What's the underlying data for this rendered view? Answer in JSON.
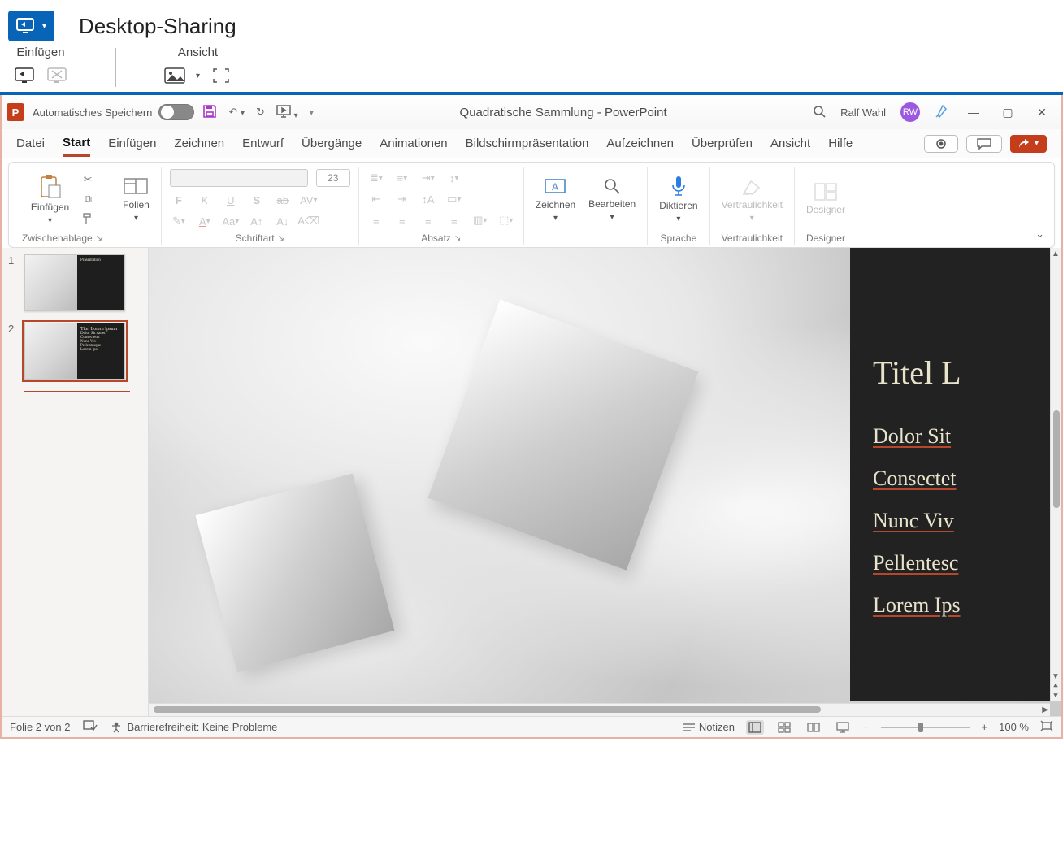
{
  "outer": {
    "title": "Desktop-Sharing",
    "groups": {
      "insert": {
        "label": "Einfügen"
      },
      "view": {
        "label": "Ansicht"
      }
    }
  },
  "titlebar": {
    "autosave_label": "Automatisches Speichern",
    "doc_title": "Quadratische Sammlung  -  PowerPoint",
    "user_name": "Ralf Wahl",
    "user_initials": "RW"
  },
  "tabs": {
    "datei": "Datei",
    "start": "Start",
    "einfuegen": "Einfügen",
    "zeichnen": "Zeichnen",
    "entwurf": "Entwurf",
    "uebergaenge": "Übergänge",
    "animationen": "Animationen",
    "praesentation": "Bildschirmpräsentation",
    "aufzeichnen": "Aufzeichnen",
    "ueberpruefen": "Überprüfen",
    "ansicht": "Ansicht",
    "hilfe": "Hilfe"
  },
  "ribbon": {
    "einfuegen_btn": "Einfügen",
    "zwischenablage": "Zwischenablage",
    "folien_btn": "Folien",
    "schriftart": "Schriftart",
    "font_size": "23",
    "absatz": "Absatz",
    "zeichnen_btn": "Zeichnen",
    "bearbeiten_btn": "Bearbeiten",
    "diktieren_btn": "Diktieren",
    "sprache": "Sprache",
    "vertraulichkeit_btn": "Vertraulichkeit",
    "vertraulichkeit": "Vertraulichkeit",
    "designer_btn": "Designer",
    "designer": "Designer"
  },
  "thumbs": {
    "n1": "1",
    "n2": "2",
    "t1_title": "Präsentation",
    "t2_title": "Titel Lorem Ipsum",
    "t2_lines": [
      "Dolor Sit Amet",
      "Consectetur",
      "Nunc Viv",
      "Pellentesque",
      "Lorem Ips"
    ]
  },
  "slide": {
    "title": "Titel L",
    "lines": [
      "Dolor Sit",
      "Consectet",
      "Nunc Viv",
      "Pellentesc",
      "Lorem Ips"
    ]
  },
  "status": {
    "slide_pos": "Folie 2 von 2",
    "accessibility": "Barrierefreiheit: Keine Probleme",
    "notes": "Notizen",
    "zoom": "100 %"
  }
}
